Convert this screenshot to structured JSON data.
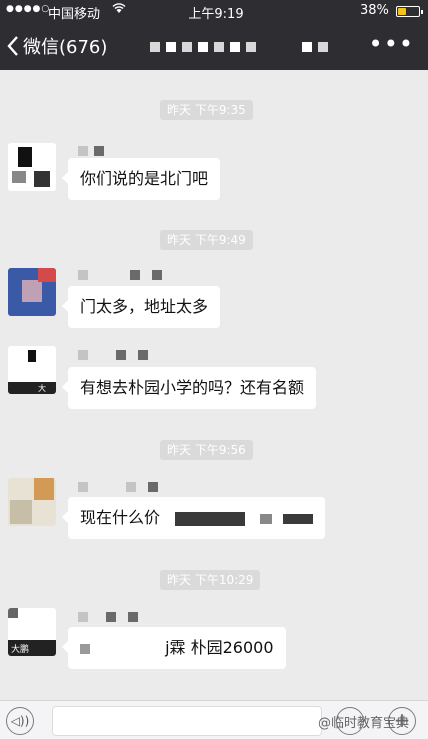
{
  "status_bar": {
    "signal": "●●●●○",
    "carrier": "中国移动",
    "wifi_icon": "wifi-icon",
    "time": "上午9:19",
    "battery_percent": "38%",
    "battery_level": 0.38
  },
  "nav": {
    "back_label": "微信(676)",
    "more_label": "•••"
  },
  "messages": [
    {
      "timestamp": "昨天 下午9:35",
      "text": "你们说的是北门吧"
    },
    {
      "timestamp": "昨天 下午9:49",
      "text": "门太多，地址太多"
    },
    {
      "timestamp": "",
      "text": "有想去朴园小学的吗？还有名额"
    },
    {
      "timestamp": "昨天 下午9:56",
      "text": "现在什么价"
    },
    {
      "timestamp": "昨天 下午10:29",
      "text": "j霖 朴园26000"
    }
  ],
  "avatar_captions": {
    "avatar_3": "大",
    "avatar_5": "大鹏"
  },
  "input_bar": {
    "voice_label": "◁))",
    "plus_label": "+"
  },
  "watermark": "@临时教育宝典"
}
